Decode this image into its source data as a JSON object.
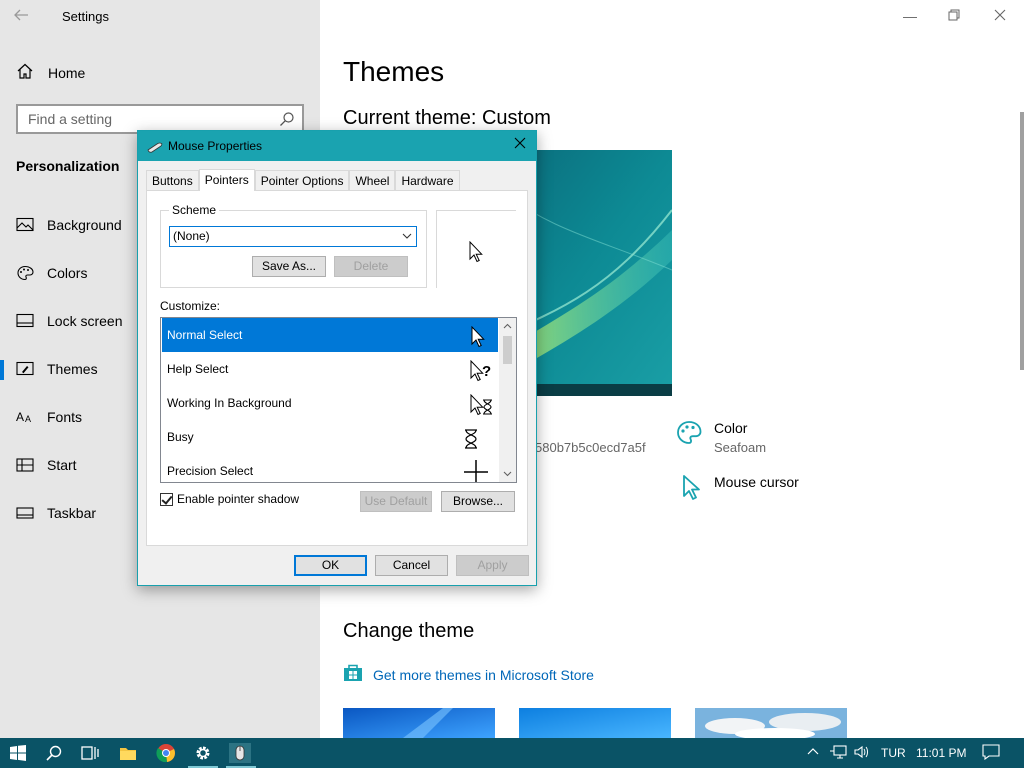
{
  "settings": {
    "title": "Settings",
    "home_label": "Home",
    "search_placeholder": "Find a setting",
    "section_title": "Personalization",
    "nav_items": [
      {
        "label": "Background"
      },
      {
        "label": "Colors"
      },
      {
        "label": "Lock screen"
      },
      {
        "label": "Themes"
      },
      {
        "label": "Fonts"
      },
      {
        "label": "Start"
      },
      {
        "label": "Taskbar"
      }
    ],
    "active_item": "Themes"
  },
  "main": {
    "heading": "Themes",
    "current_theme": "Current theme: Custom",
    "background_hash": "580b7b5c0ecd7a5f",
    "color_label": "Color",
    "color_value": "Seafoam",
    "mouse_cursor_label": "Mouse cursor",
    "change_theme_title": "Change theme",
    "store_link": "Get more themes in Microsoft Store"
  },
  "dialog": {
    "title": "Mouse Properties",
    "tabs": [
      "Buttons",
      "Pointers",
      "Pointer Options",
      "Wheel",
      "Hardware"
    ],
    "active_tab": "Pointers",
    "scheme_label": "Scheme",
    "scheme_value": "(None)",
    "save_as": "Save As...",
    "delete": "Delete",
    "customize_label": "Customize:",
    "pointers": [
      {
        "name": "Normal Select",
        "icon": "arrow-cursor-icon"
      },
      {
        "name": "Help Select",
        "icon": "help-cursor-icon"
      },
      {
        "name": "Working In Background",
        "icon": "working-cursor-icon"
      },
      {
        "name": "Busy",
        "icon": "hourglass-cursor-icon"
      },
      {
        "name": "Precision Select",
        "icon": "crosshair-cursor-icon"
      }
    ],
    "selected_pointer": "Normal Select",
    "shadow_label": "Enable pointer shadow",
    "shadow_checked": true,
    "use_default": "Use Default",
    "browse": "Browse...",
    "ok": "OK",
    "cancel": "Cancel",
    "apply": "Apply"
  },
  "taskbar": {
    "language": "TUR",
    "time": "11:01 PM"
  },
  "colors": {
    "accent": "#0078d7",
    "seafoam": "#1aa3b0",
    "taskbar": "#0a5366"
  }
}
